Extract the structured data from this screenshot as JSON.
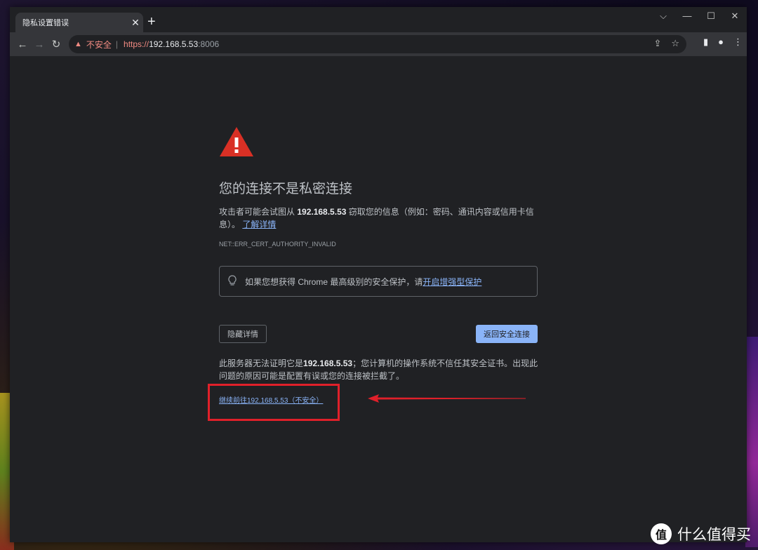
{
  "tab": {
    "title": "隐私设置错误",
    "close": "✕",
    "new_tab": "+"
  },
  "window_controls": {
    "dropdown": "⌵",
    "minimize": "—",
    "maximize": "☐",
    "close": "✕"
  },
  "nav": {
    "back": "←",
    "forward": "→",
    "reload": "↻"
  },
  "address": {
    "warning_icon": "▲",
    "insecure_label": "不安全",
    "separator": "|",
    "scheme": "https://",
    "host": "192.168.5.53",
    "port": ":8006"
  },
  "omnibox_icons": {
    "share": "⇪",
    "bookmark": "☆"
  },
  "toolbar_icons": {
    "sidepanel": "▮",
    "profile": "●",
    "menu": "⋮"
  },
  "page": {
    "heading": "您的连接不是私密连接",
    "para_part1": "攻击者可能会试图从 ",
    "para_host": "192.168.5.53",
    "para_part2": " 窃取您的信息（例如：密码、通讯内容或信用卡信息）。",
    "learn_more": "了解详情",
    "error_code": "NET::ERR_CERT_AUTHORITY_INVALID",
    "hint_text": "如果您想获得 Chrome 最高级别的安全保护，请",
    "hint_link": "开启增强型保护",
    "hide_details": "隐藏详情",
    "back_to_safety": "返回安全连接",
    "detail_part1": "此服务器无法证明它是",
    "detail_host": "192.168.5.53",
    "detail_part2": "；您计算机的操作系统不信任其安全证书。出现此问题的原因可能是配置有误或您的连接被拦截了。",
    "proceed_link": "继续前往192.168.5.53（不安全）"
  },
  "watermark": {
    "logo": "值",
    "text": "什么值得买"
  },
  "colors": {
    "warning_red": "#d93025",
    "link_blue": "#8ab4f8",
    "annotation_red": "#e0202a"
  }
}
